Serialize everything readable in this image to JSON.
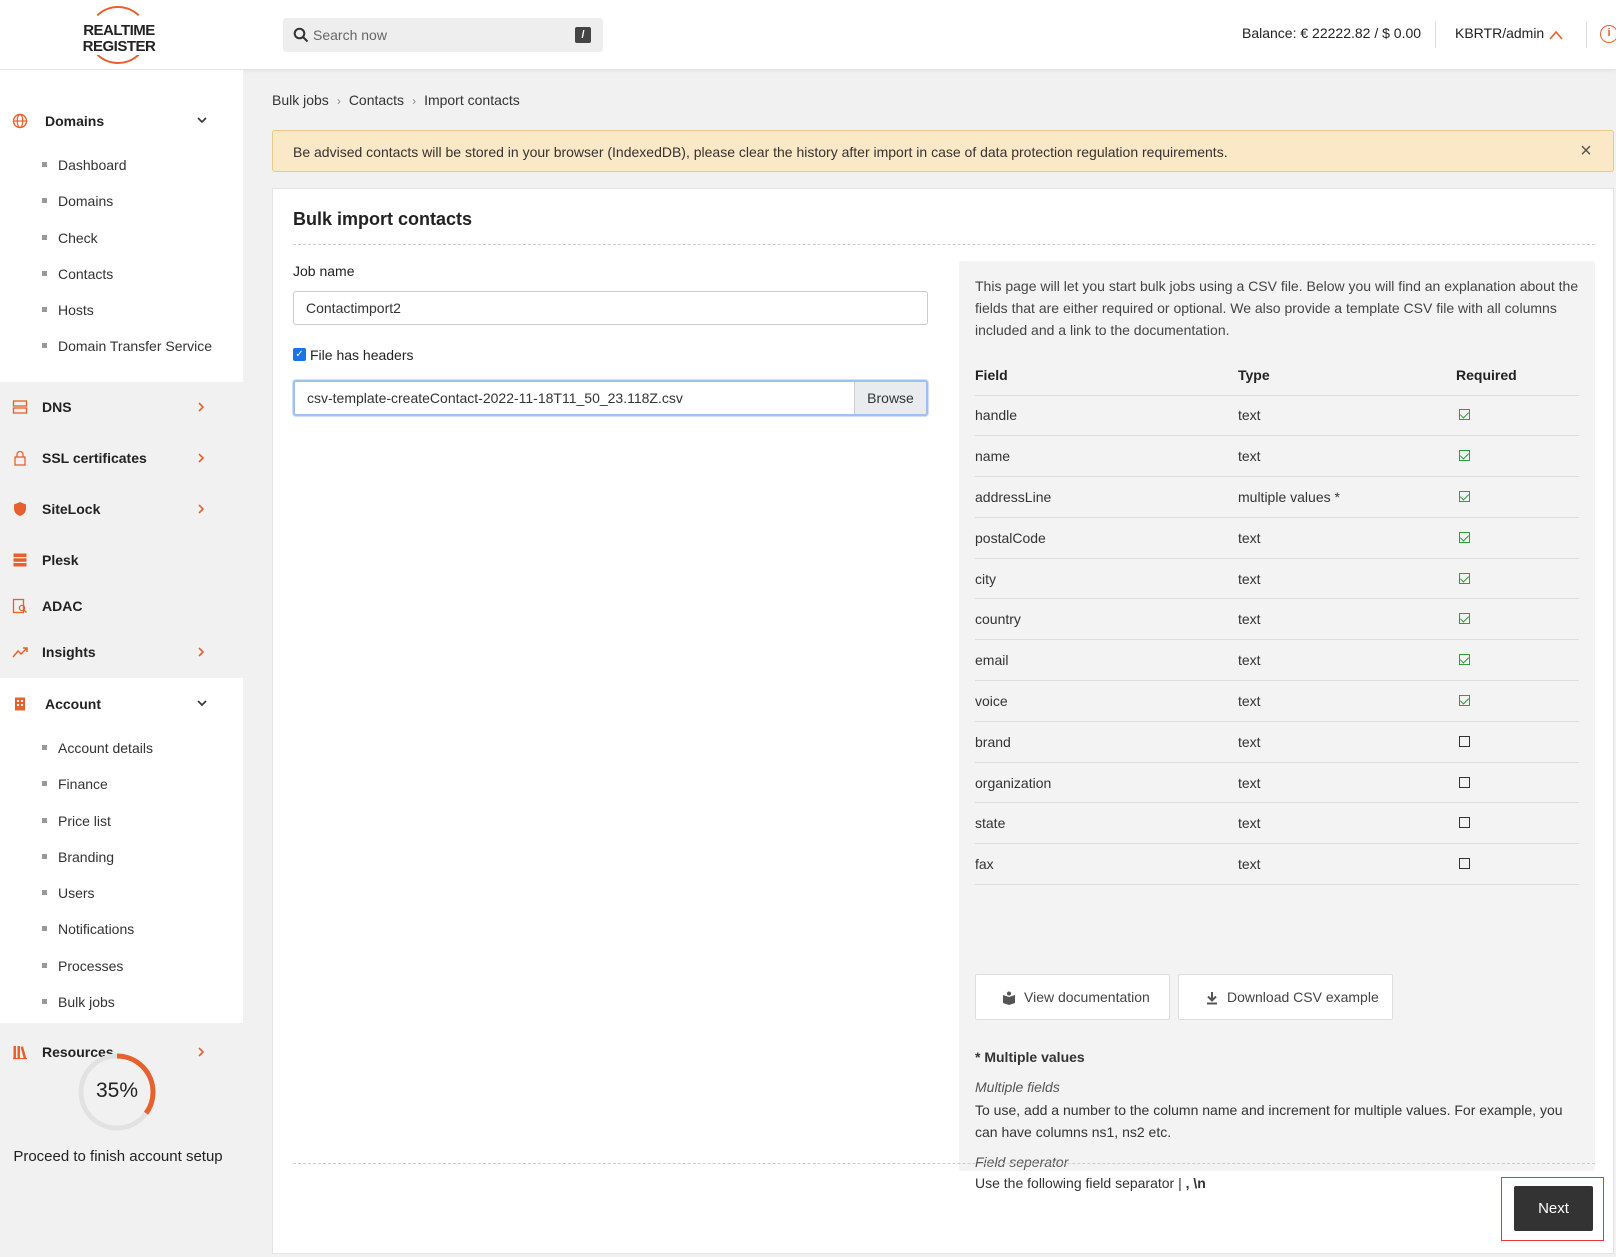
{
  "header": {
    "logo_line1": "REALTIME",
    "logo_line2": "REGISTER",
    "search_placeholder": "Search now",
    "search_shortcut": "/",
    "balance": "Balance: € 22222.82 / $ 0.00",
    "user": "KBRTR/admin",
    "info_glyph": "i"
  },
  "sidebar": {
    "domains": {
      "label": "Domains",
      "items": [
        "Dashboard",
        "Domains",
        "Check",
        "Contacts",
        "Hosts",
        "Domain Transfer Service"
      ]
    },
    "dns": "DNS",
    "ssl": "SSL certificates",
    "sitelock": "SiteLock",
    "plesk": "Plesk",
    "adac": "ADAC",
    "insights": "Insights",
    "account": {
      "label": "Account",
      "items": [
        "Account details",
        "Finance",
        "Price list",
        "Branding",
        "Users",
        "Notifications",
        "Processes",
        "Bulk jobs"
      ]
    },
    "resources": "Resources",
    "progress": {
      "value": 0.35,
      "label": "35%",
      "text": "Proceed to finish account setup"
    }
  },
  "breadcrumb": [
    "Bulk jobs",
    "Contacts",
    "Import contacts"
  ],
  "breadcrumb_sep": "›",
  "alert": {
    "message": "Be advised contacts will be stored in your browser (IndexedDB), please clear the history after import in case of data protection regulation requirements.",
    "close": "×"
  },
  "form": {
    "title": "Bulk import contacts",
    "job_label": "Job name",
    "job_value": "Contactimport2",
    "headers_checked": true,
    "check_glyph": "✓",
    "headers_label": "File has headers",
    "file_name": "csv-template-createContact-2022-11-18T11_50_23.118Z.csv",
    "browse": "Browse",
    "next": "Next"
  },
  "info": {
    "intro": "This page will let you start bulk jobs using a CSV file. Below you will find an explanation about the fields that are either required or optional. We also provide a template CSV file with all columns included and a link to the documentation.",
    "columns": [
      "Field",
      "Type",
      "Required"
    ],
    "rows": [
      {
        "field": "handle",
        "type": "text",
        "required": true
      },
      {
        "field": "name",
        "type": "text",
        "required": true
      },
      {
        "field": "addressLine",
        "type": "multiple values *",
        "required": true
      },
      {
        "field": "postalCode",
        "type": "text",
        "required": true
      },
      {
        "field": "city",
        "type": "text",
        "required": true
      },
      {
        "field": "country",
        "type": "text",
        "required": true
      },
      {
        "field": "email",
        "type": "text",
        "required": true
      },
      {
        "field": "voice",
        "type": "text",
        "required": true
      },
      {
        "field": "brand",
        "type": "text",
        "required": false
      },
      {
        "field": "organization",
        "type": "text",
        "required": false
      },
      {
        "field": "state",
        "type": "text",
        "required": false
      },
      {
        "field": "fax",
        "type": "text",
        "required": false
      }
    ],
    "view_doc": "View documentation",
    "download_csv": "Download CSV example",
    "mv_heading": "* Multiple values",
    "mv_sub1": "Multiple fields",
    "mv_text1": "To use, add a number to the column name and increment for multiple values. For example, you can have columns ns1, ns2 etc.",
    "mv_sub2": "Field seperator",
    "mv_text2": "Use the following field separator |",
    "mv_text2_bold": " , \\n"
  },
  "colors": {
    "accent": "#e8602c",
    "check": "#2e9e3e",
    "alert_bg": "#fbe8c6",
    "button_dark": "#333333"
  }
}
